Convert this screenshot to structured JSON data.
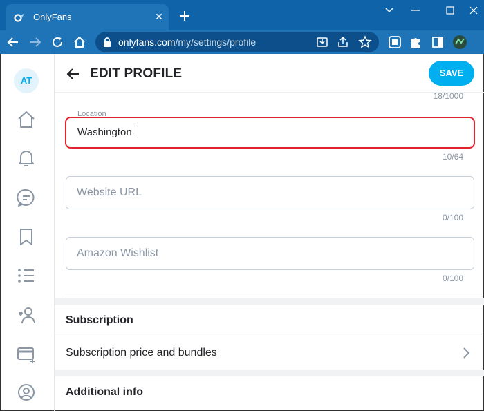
{
  "browser": {
    "tab_title": "OnlyFans",
    "url_host": "onlyfans.com",
    "url_path": "/my/settings/profile"
  },
  "sidebar": {
    "avatar_initials": "AT",
    "items": [
      "home-icon",
      "bell-icon",
      "messages-icon",
      "bookmark-icon",
      "lists-icon",
      "subscriptions-icon",
      "card-icon",
      "profile-icon"
    ]
  },
  "header": {
    "title": "EDIT PROFILE",
    "save_label": "SAVE"
  },
  "form": {
    "about_counter": "18/1000",
    "location": {
      "label": "Location",
      "value": "Washington",
      "counter": "10/64"
    },
    "website": {
      "placeholder": "Website URL",
      "counter": "0/100"
    },
    "wishlist": {
      "placeholder": "Amazon Wishlist",
      "counter": "0/100"
    }
  },
  "sections": {
    "subscription_title": "Subscription",
    "subscription_row": "Subscription price and bundles",
    "additional_title": "Additional info"
  },
  "colors": {
    "accent": "#00aff0",
    "highlight": "#e0232d",
    "chrome": "#1f73b7"
  }
}
